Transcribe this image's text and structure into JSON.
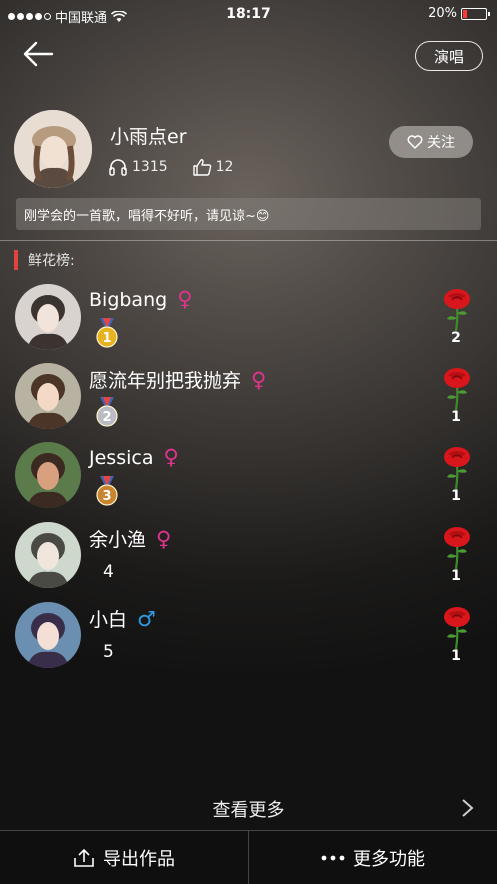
{
  "status_bar": {
    "carrier": "中国联通",
    "time": "18:17",
    "battery": "20%",
    "battery_level": 0.2
  },
  "header": {
    "sing_button": "演唱"
  },
  "profile": {
    "username": "小雨点er",
    "listens": "1315",
    "likes": "12",
    "follow_label": "关注",
    "description": "刚学会的一首歌，唱得不好听，请见谅~😊"
  },
  "ranking": {
    "title": "鲜花榜:",
    "items": [
      {
        "name": "Bigbang",
        "gender": "female",
        "gender_symbol": "♀",
        "rank": "1",
        "medal": "gold",
        "flowers": "2"
      },
      {
        "name": "愿流年别把我抛弃",
        "gender": "female",
        "gender_symbol": "♀",
        "rank": "2",
        "medal": "silver",
        "flowers": "1"
      },
      {
        "name": "Jessica",
        "gender": "female",
        "gender_symbol": "♀",
        "rank": "3",
        "medal": "bronze",
        "flowers": "1"
      },
      {
        "name": "余小渔",
        "gender": "female",
        "gender_symbol": "♀",
        "rank": "4",
        "medal": "none",
        "flowers": "1"
      },
      {
        "name": "小白",
        "gender": "male",
        "gender_symbol": "♂",
        "rank": "5",
        "medal": "none",
        "flowers": "1"
      }
    ]
  },
  "more": {
    "label": "查看更多"
  },
  "footer": {
    "export_label": "导出作品",
    "more_label": "更多功能"
  },
  "colors": {
    "female": "#e0338d",
    "male": "#2e9be0",
    "accent_bar": "#e2443c",
    "rose": "#d8161b"
  }
}
